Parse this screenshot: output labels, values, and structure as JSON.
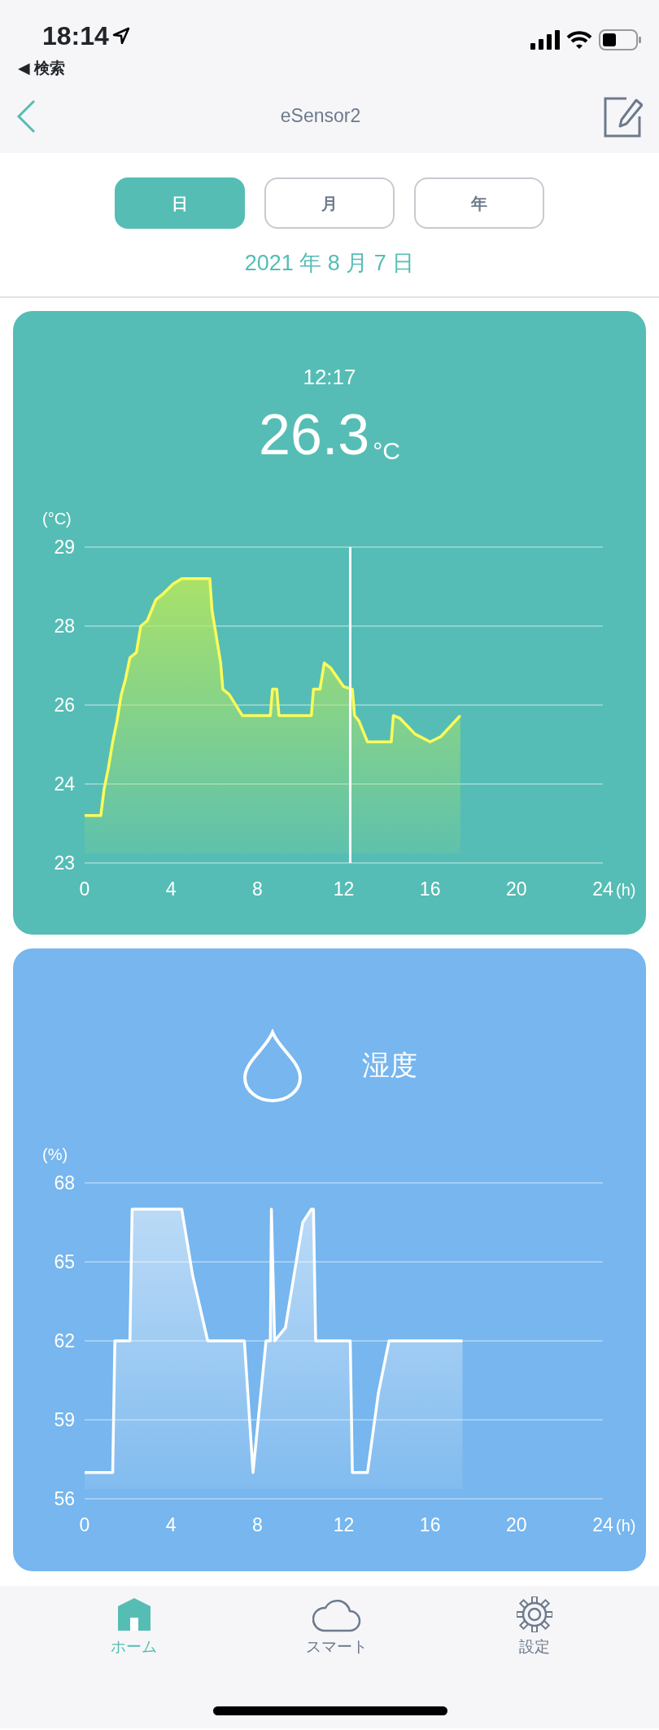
{
  "status_bar": {
    "time": "18:14",
    "back_label": "◀ 検索"
  },
  "nav_bar": {
    "title": "eSensor2"
  },
  "period_tabs": [
    {
      "label": "日",
      "selected": true
    },
    {
      "label": "月",
      "selected": false
    },
    {
      "label": "年",
      "selected": false
    }
  ],
  "date": "2021 年 8 月 7 日",
  "cards": [
    {
      "kind": "temperature",
      "time": "12:17",
      "value": "26.3",
      "unit": "°C",
      "chart_data": {
        "type": "area",
        "xlabel": "(h)",
        "ylabel": "(°C)",
        "xlim": [
          0,
          24
        ],
        "ylim": [
          23,
          29
        ],
        "xticks": [
          0,
          4,
          8,
          12,
          16,
          20,
          24
        ],
        "yticks": [
          {
            "value": 23,
            "label": "23"
          },
          {
            "value": 24.5,
            "label": "24"
          },
          {
            "value": 26,
            "label": "26"
          },
          {
            "value": 27.5,
            "label": "28"
          },
          {
            "value": 29,
            "label": "29"
          }
        ],
        "x": [
          0,
          0.75,
          0.9,
          1.1,
          1.3,
          1.5,
          1.7,
          1.9,
          2.1,
          2.4,
          2.6,
          2.9,
          3.3,
          3.6,
          4.1,
          4.5,
          5.8,
          5.9,
          6.1,
          6.3,
          6.4,
          6.7,
          7.3,
          8.6,
          8.7,
          8.9,
          9.0,
          10.5,
          10.6,
          10.9,
          11.1,
          11.4,
          12.0,
          12.4,
          12.5,
          12.7,
          13.1,
          14.2,
          14.3,
          14.6,
          15.3,
          16.0,
          16.5,
          17.4
        ],
        "series": [
          {
            "color": "#fbfb5a",
            "values": [
              23.9,
              23.9,
              24.4,
              24.8,
              25.3,
              25.7,
              26.2,
              26.5,
              26.9,
              27.0,
              27.5,
              27.6,
              28.0,
              28.1,
              28.3,
              28.4,
              28.4,
              27.8,
              27.3,
              26.8,
              26.3,
              26.2,
              25.8,
              25.8,
              26.3,
              26.3,
              25.8,
              25.8,
              26.3,
              26.3,
              26.8,
              26.7,
              26.35,
              26.3,
              25.8,
              25.7,
              25.3,
              25.3,
              25.8,
              25.75,
              25.45,
              25.3,
              25.4,
              25.8
            ]
          }
        ],
        "grid": true,
        "ref_lines": [
          {
            "axis": "x",
            "value": 12.3,
            "color": "#ffffff"
          }
        ]
      }
    },
    {
      "kind": "humidity",
      "title": "湿度",
      "chart_data": {
        "type": "area",
        "xlabel": "(h)",
        "ylabel": "(%)",
        "xlim": [
          0,
          24
        ],
        "ylim": [
          56,
          68
        ],
        "xticks": [
          0,
          4,
          8,
          12,
          16,
          20,
          24
        ],
        "yticks": [
          56,
          59,
          62,
          65,
          68
        ],
        "x": [
          0,
          1.3,
          1.4,
          2.1,
          2.2,
          4.5,
          5.0,
          5.7,
          7.4,
          7.8,
          8.4,
          8.6,
          8.65,
          8.8,
          9.3,
          10.1,
          10.5,
          10.6,
          10.7,
          12.3,
          12.4,
          13.1,
          13.6,
          14.1,
          17.5
        ],
        "grid": true,
        "series": [
          {
            "color": "#ffffff",
            "values": [
              57,
              57,
              62,
              62,
              67,
              67,
              64.5,
              62,
              62,
              57,
              62,
              62,
              67,
              62,
              62.5,
              66.5,
              67,
              67,
              62,
              62,
              57,
              57,
              60,
              62,
              62
            ]
          }
        ]
      }
    }
  ],
  "bottom_tabs": [
    {
      "label": "ホーム",
      "kind": "home",
      "selected": true
    },
    {
      "label": "スマート",
      "kind": "cloud",
      "selected": false
    },
    {
      "label": "設定",
      "kind": "settings",
      "selected": false
    }
  ]
}
